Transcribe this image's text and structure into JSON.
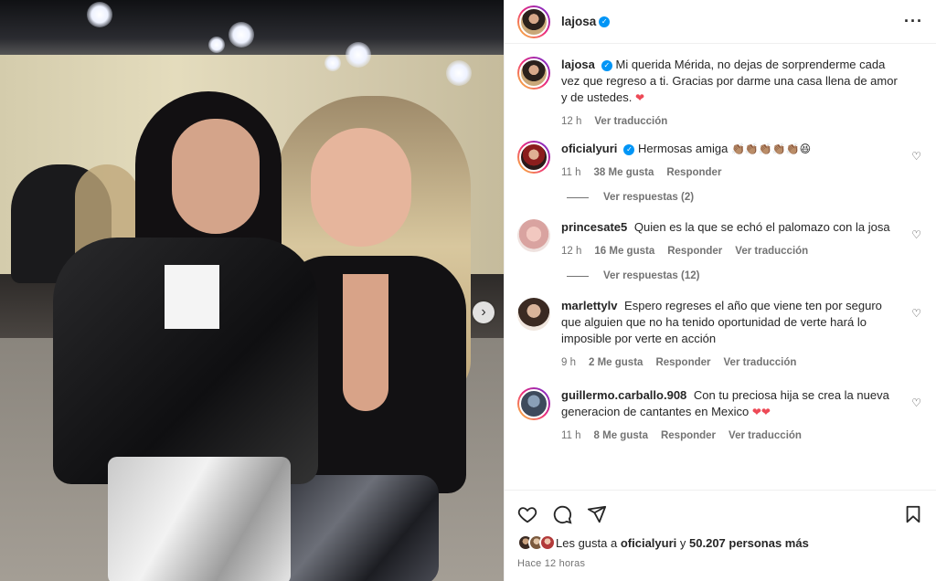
{
  "post": {
    "author": "lajosa",
    "caption": "Mi querida Mérida, no dejas de sorprenderme cada vez que regreso a ti. Gracias por darme una casa llena de amor y de ustedes.",
    "caption_emoji": "❤",
    "caption_time": "12 h",
    "caption_translate": "Ver traducción"
  },
  "comments": [
    {
      "user": "oficialyuri",
      "verified": true,
      "text": "Hermosas amiga",
      "emoji": "👏🏽👏🏽👏🏽👏🏽👏🏽😆",
      "time": "11 h",
      "likes": "38 Me gusta",
      "reply": "Responder",
      "translate": "",
      "replies": "Ver respuestas (2)"
    },
    {
      "user": "princesate5",
      "verified": false,
      "text": "Quien es la que se echó el palomazo con la josa",
      "emoji": "",
      "time": "12 h",
      "likes": "16 Me gusta",
      "reply": "Responder",
      "translate": "Ver traducción",
      "replies": "Ver respuestas (12)"
    },
    {
      "user": "marlettylv",
      "verified": false,
      "text": "Espero regreses el año que viene ten por seguro que alguien que no ha tenido oportunidad de verte hará lo imposible por verte en acción",
      "emoji": "",
      "time": "9 h",
      "likes": "2 Me gusta",
      "reply": "Responder",
      "translate": "Ver traducción",
      "replies": ""
    },
    {
      "user": "guillermo.carballo.908",
      "verified": false,
      "text": "Con tu preciosa hija se crea la nueva generacion de cantantes en Mexico",
      "emoji": "❤❤",
      "time": "11 h",
      "likes": "8 Me gusta",
      "reply": "Responder",
      "translate": "Ver traducción",
      "replies": ""
    }
  ],
  "footer": {
    "likes_prefix": "Les gusta a",
    "likes_user": "oficialyuri",
    "likes_and": "y",
    "likes_count": "50.207 personas más",
    "posted": "Hace 12 horas"
  },
  "icons": {
    "more": "more-horizontal-icon",
    "like": "heart-icon",
    "comment": "comment-icon",
    "share": "share-icon",
    "save": "bookmark-icon",
    "next": "chevron-right-icon"
  },
  "colors": {
    "verified": "#0095f6",
    "heart": "#ed4956",
    "meta": "#737373"
  }
}
